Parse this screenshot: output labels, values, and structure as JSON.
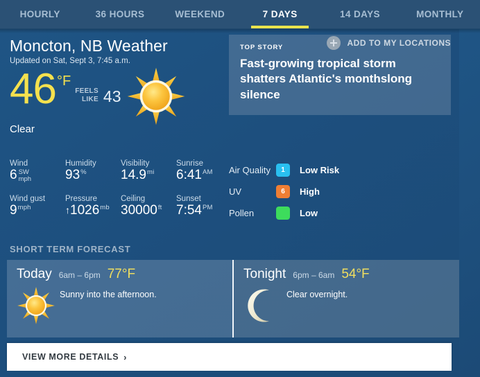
{
  "tabs": [
    {
      "label": "HOURLY",
      "active": false
    },
    {
      "label": "36 HOURS",
      "active": false
    },
    {
      "label": "WEEKEND",
      "active": false
    },
    {
      "label": "7 DAYS",
      "active": true
    },
    {
      "label": "14 DAYS",
      "active": false
    },
    {
      "label": "MONTHLY",
      "active": false
    }
  ],
  "header": {
    "title": "Moncton, NB Weather",
    "updated": "Updated on Sat, Sept 3, 7:45 a.m.",
    "add_location_label": "ADD TO MY LOCATIONS"
  },
  "current": {
    "temperature": "46",
    "degree_unit": "°F",
    "feels_like_line1": "FEELS",
    "feels_like_line2": "LIKE",
    "feels_like_value": "43",
    "condition": "Clear",
    "icon": "sun-icon"
  },
  "top_story": {
    "kicker": "TOP STORY",
    "headline": "Fast-growing tropical storm shatters Atlantic's monthslong silence"
  },
  "metrics": [
    [
      {
        "label": "Wind",
        "value": "6",
        "unit_stack_top": "SW",
        "unit_stack_bottom": "mph"
      },
      {
        "label": "Humidity",
        "value": "93",
        "unit": "%"
      },
      {
        "label": "Visibility",
        "value": "14.9",
        "unit": "mi"
      },
      {
        "label": "Sunrise",
        "value": "6:41",
        "unit": "AM"
      }
    ],
    [
      {
        "label": "Wind gust",
        "value": "9",
        "unit": "mph"
      },
      {
        "label": "Pressure",
        "value": "1026",
        "unit": "mb",
        "prefix": "↑"
      },
      {
        "label": "Ceiling",
        "value": "30000",
        "unit": "ft"
      },
      {
        "label": "Sunset",
        "value": "7:54",
        "unit": "PM"
      }
    ]
  ],
  "indices": [
    {
      "name": "Air Quality",
      "badge": "1",
      "status": "Low Risk",
      "color": "#29bff0"
    },
    {
      "name": "UV",
      "badge": "6",
      "status": "High",
      "color": "#ef7e34"
    },
    {
      "name": "Pollen",
      "badge": "",
      "status": "Low",
      "color": "#3ddc5c"
    }
  ],
  "short_term": {
    "title": "SHORT TERM FORECAST",
    "cards": [
      {
        "name": "Today",
        "range": "6am – 6pm",
        "temp": "77°F",
        "description": "Sunny into the afternoon.",
        "icon": "sun-icon"
      },
      {
        "name": "Tonight",
        "range": "6pm – 6am",
        "temp": "54°F",
        "description": "Clear overnight.",
        "icon": "moon-icon"
      }
    ]
  },
  "bottom": {
    "view_more_label": "VIEW MORE DETAILS",
    "chevron": "›"
  },
  "colors": {
    "accent_yellow": "#f5e14e",
    "tab_underline": "#e9e34d",
    "background_top": "#1f5585",
    "background_bottom": "#1c4a76"
  }
}
